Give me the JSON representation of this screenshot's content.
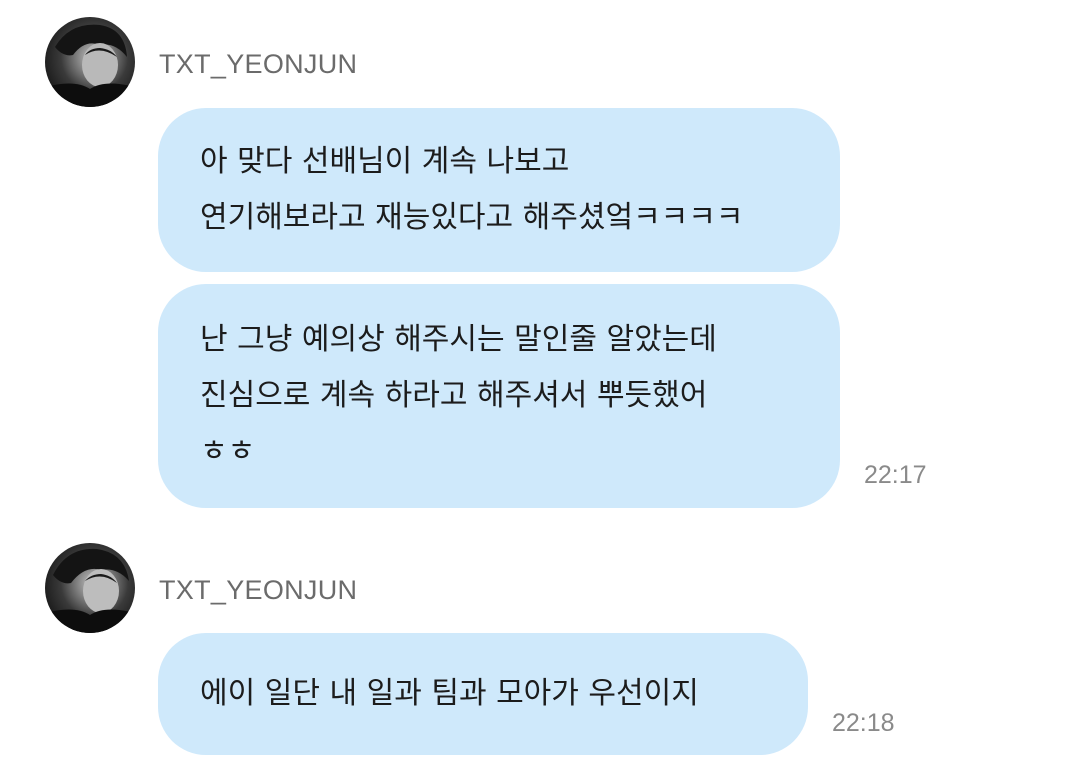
{
  "groups": [
    {
      "sender": "TXT_YEONJUN",
      "messages": [
        {
          "lines": [
            "아 맞다 선배님이 계속 나보고",
            "연기해보라고 재능있다고 해주셨엌ㅋㅋㅋㅋ"
          ]
        },
        {
          "lines": [
            "난 그냥 예의상 해주시는 말인줄 알았는데",
            "진심으로 계속 하라고 해주셔서 뿌듯했어",
            "ㅎㅎ"
          ]
        }
      ],
      "time": "22:17"
    },
    {
      "sender": "TXT_YEONJUN",
      "messages": [
        {
          "lines": [
            "에이 일단 내 일과 팀과 모아가 우선이지"
          ]
        }
      ],
      "time": "22:18"
    }
  ],
  "colors": {
    "bubble": "#cfe9fb",
    "text": "#1c1c1c",
    "sender": "#6b6b6b",
    "time": "#8a8a8a"
  }
}
